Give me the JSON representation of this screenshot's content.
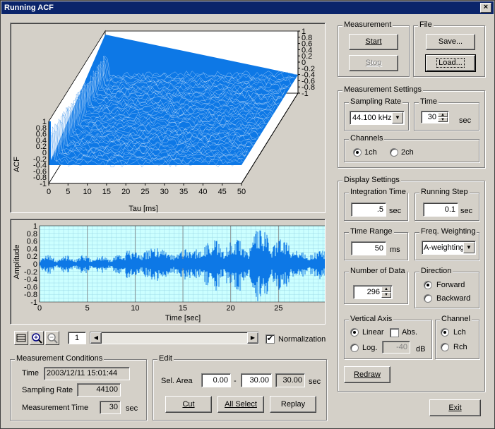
{
  "window": {
    "title": "Running ACF",
    "close_label": "×"
  },
  "acf_plot": {
    "ylabel": "ACF",
    "xlabel": "Tau [ms]",
    "x_ticks": [
      "0",
      "5",
      "10",
      "15",
      "20",
      "25",
      "30",
      "35",
      "40",
      "45",
      "50"
    ],
    "front_y_ticks": [
      "1",
      "0.8",
      "0.6",
      "0.4",
      "0.2",
      "0",
      "-0.2",
      "-0.4",
      "-0.6",
      "-0.8",
      "-1"
    ],
    "back_y_ticks": [
      "1",
      "0.8",
      "0.6",
      "0.4",
      "0.2",
      "0",
      "-0.2",
      "-0.4",
      "-0.6",
      "-0.8",
      "-1"
    ],
    "color": "#0d78e6"
  },
  "wave_plot": {
    "ylabel": "Amplitude",
    "xlabel": "Time [sec]",
    "x_ticks": [
      "0",
      "5",
      "10",
      "15",
      "20",
      "25"
    ],
    "y_ticks": [
      "1",
      "0.8",
      "0.6",
      "0.4",
      "0.2",
      "0",
      "-0.2",
      "-0.4",
      "-0.6",
      "-0.8",
      "-1"
    ],
    "bg": "#ccffff",
    "grid": "#9ad8e8",
    "color": "#0d78e6"
  },
  "toolbar": {
    "page_num": "1",
    "normalization_label": "Normalization",
    "normalization_checked": true
  },
  "measurement": {
    "legend": "Measurement",
    "start": "Start",
    "stop": "Stop"
  },
  "file": {
    "legend": "File",
    "save": "Save...",
    "load": "Load..."
  },
  "measurement_settings": {
    "legend": "Measurement Settings",
    "sampling_rate_legend": "Sampling Rate",
    "sampling_rate": "44.100 kHz",
    "time_legend": "Time",
    "time_value": "30",
    "time_unit": "sec",
    "channels_legend": "Channels",
    "ch1": "1ch",
    "ch2": "2ch"
  },
  "display_settings": {
    "legend": "Display Settings",
    "integration_legend": "Integration Time",
    "integration_value": ".5",
    "integration_unit": "sec",
    "running_step_legend": "Running Step",
    "running_step_value": "0.1",
    "running_step_unit": "sec",
    "time_range_legend": "Time Range",
    "time_range_value": "50",
    "time_range_unit": "ms",
    "freq_weighting_legend": "Freq. Weighting",
    "freq_weighting": "A-weighting",
    "num_data_legend": "Number of Data",
    "num_data_value": "296",
    "direction_legend": "Direction",
    "forward": "Forward",
    "backward": "Backward",
    "vertical_axis_legend": "Vertical Axis",
    "linear": "Linear",
    "abs": "Abs.",
    "log": "Log.",
    "log_value": "-40",
    "log_unit": "dB",
    "channel_legend": "Channel",
    "lch": "Lch",
    "rch": "Rch",
    "redraw": "Redraw"
  },
  "measurement_conditions": {
    "legend": "Measurement Conditions",
    "time_label": "Time",
    "time_value": "2003/12/11 15:01:44",
    "sampling_rate_label": "Sampling Rate",
    "sampling_rate_value": "44100",
    "measurement_time_label": "Measurement Time",
    "measurement_time_value": "30",
    "measurement_time_unit": "sec"
  },
  "edit": {
    "legend": "Edit",
    "sel_area_label": "Sel. Area",
    "from": "0.00",
    "dash": "-",
    "to": "30.00",
    "length": "30.00",
    "unit": "sec",
    "cut": "Cut",
    "all_select": "All Select",
    "replay": "Replay"
  },
  "exit": "Exit"
}
